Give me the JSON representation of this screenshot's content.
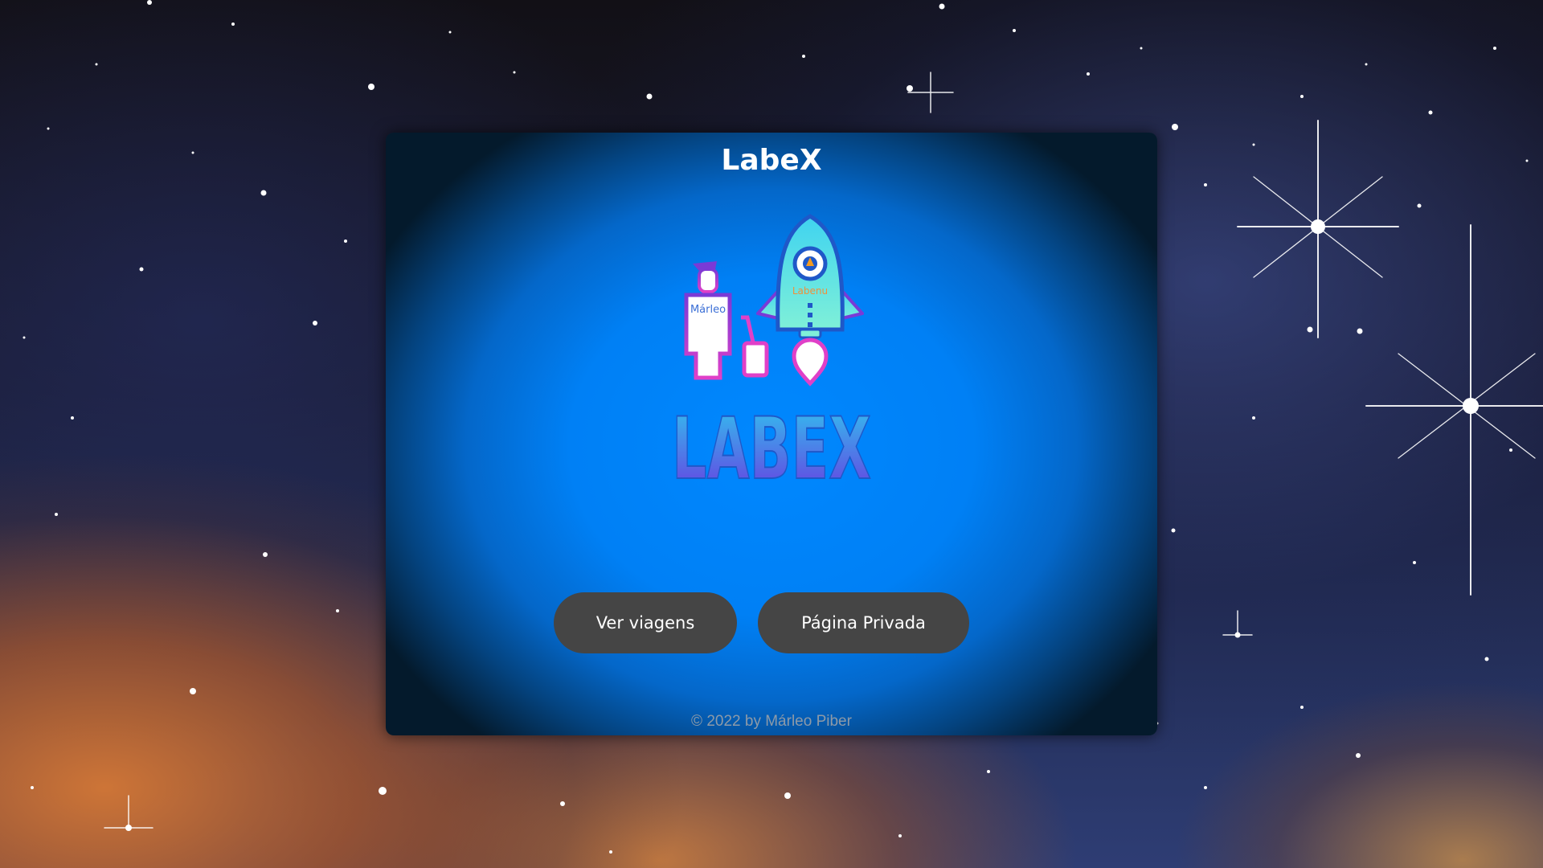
{
  "header": {
    "title": "LabeX"
  },
  "logo": {
    "wordmark": "LABEX",
    "person_label": "Márleo",
    "rocket_label": "Labenu",
    "icons": [
      "traveler-icon",
      "suitcase-icon",
      "rocket-icon",
      "location-pin-icon"
    ]
  },
  "actions": {
    "view_trips_label": "Ver viagens",
    "private_page_label": "Página Privada"
  },
  "footer": {
    "copyright": "© 2022 by Márleo Piber"
  },
  "colors": {
    "card_center": "#0088ff",
    "card_edge": "#041a2c",
    "button_bg": "#454545",
    "button_text": "#ffffff",
    "logo_magenta": "#e040c8",
    "logo_violet": "#7a3ad6",
    "logo_cyan": "#3fd3f0"
  }
}
